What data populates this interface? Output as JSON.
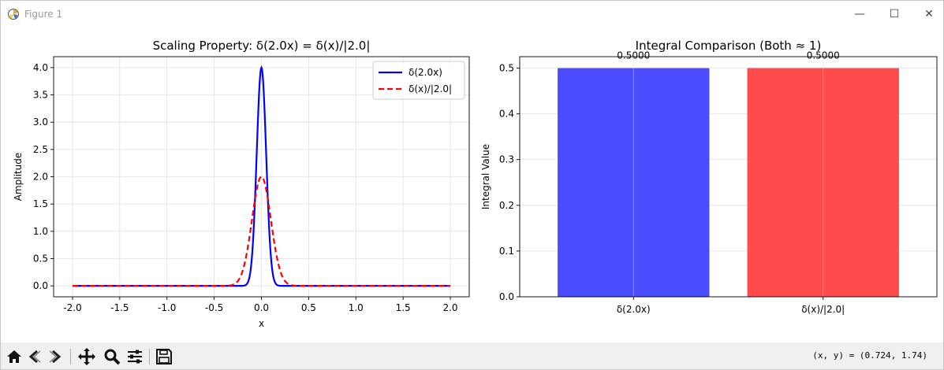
{
  "window": {
    "title": "Figure 1",
    "buttons": {
      "minimize": "—",
      "maximize": "☐",
      "close": "✕"
    }
  },
  "toolbar": {
    "icons": [
      "home-icon",
      "back-arrow-icon",
      "forward-arrow-icon",
      "pan-move-icon",
      "zoom-magnifier-icon",
      "configure-subplots-icon",
      "save-disk-icon"
    ],
    "coords_text": "(x, y) = (0.724, 1.74)"
  },
  "chart_data": [
    {
      "type": "line",
      "title": "Scaling Property: δ(2.0x) = δ(x)/|2.0|",
      "xlabel": "x",
      "ylabel": "Amplitude",
      "xlim": [
        -2.2,
        2.2
      ],
      "ylim": [
        -0.2,
        4.2
      ],
      "xticks": [
        -2.0,
        -1.5,
        -1.0,
        -0.5,
        0.0,
        0.5,
        1.0,
        1.5,
        2.0
      ],
      "xtick_labels": [
        "-2.0",
        "-1.5",
        "-1.0",
        "-0.5",
        "0.0",
        "0.5",
        "1.0",
        "1.5",
        "2.0"
      ],
      "yticks": [
        0.0,
        0.5,
        1.0,
        1.5,
        2.0,
        2.5,
        3.0,
        3.5,
        4.0
      ],
      "ytick_labels": [
        "0.0",
        "0.5",
        "1.0",
        "1.5",
        "2.0",
        "2.5",
        "3.0",
        "3.5",
        "4.0"
      ],
      "grid": true,
      "legend_position": "top-right",
      "series": [
        {
          "name": "δ(2.0x)",
          "color": "#0000ff",
          "style": "solid",
          "gaussian_peak": 4.0,
          "gaussian_sigma": 0.05,
          "x_range": [
            -2.0,
            2.0
          ]
        },
        {
          "name": "δ(x)/|2.0|",
          "color": "#ff0000",
          "style": "dashed",
          "gaussian_peak": 2.0,
          "gaussian_sigma": 0.1,
          "x_range": [
            -2.0,
            2.0
          ]
        }
      ]
    },
    {
      "type": "bar",
      "title": "Integral Comparison (Both ≈ 1)",
      "xlabel": "",
      "ylabel": "Integral Value",
      "categories": [
        "δ(2.0x)",
        "δ(x)/|2.0|"
      ],
      "values": [
        0.5,
        0.5
      ],
      "value_labels": [
        "0.5000",
        "0.5000"
      ],
      "colors": [
        "#4b4bff",
        "#ff4b4b"
      ],
      "ylim": [
        0,
        0.525
      ],
      "yticks": [
        0.0,
        0.1,
        0.2,
        0.3,
        0.4,
        0.5
      ],
      "ytick_labels": [
        "0.0",
        "0.1",
        "0.2",
        "0.3",
        "0.4",
        "0.5"
      ],
      "grid": true
    }
  ]
}
